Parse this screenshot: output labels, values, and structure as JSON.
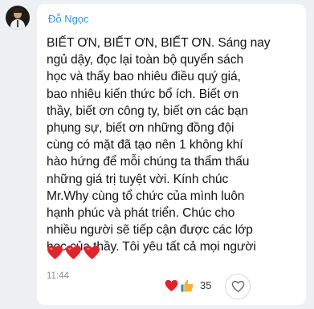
{
  "message": {
    "sender_name": "Đỗ Ngọc",
    "text": "BIẾT ƠN, BIẾT ƠN, BIẾT ƠN. Sáng nay\nngủ dậy, đọc lại toàn bộ quyển sách\nhọc và thấy bao nhiêu điều quý giá,\nbao nhiêu kiến thức bổ ích. Biết ơn\nthầy, biết ơn công ty, biết ơn các bạn\nphụng sự, biết ơn những đồng đội\ncùng có mặt đã tạo nên 1 không khí\nhào hứng để mỗi chúng ta thẩm thấu\nnhững giá trị tuyệt vời. Kính chúc\nMr.Why cùng tổ chức của mình luôn\nhạnh phúc và phát triển. Chúc cho\nnhiều người sẽ tiếp cận được các lớp\nhọc của thầy. Tôi yêu tất cả mọi người",
    "emoji": [
      "red-heart",
      "red-heart",
      "red-heart"
    ],
    "time": "11:44"
  },
  "reactions": {
    "icons": [
      "heart-emoji",
      "thumbs-up-emoji"
    ],
    "count": "35"
  },
  "colors": {
    "background": "#eef0f3",
    "bubble": "#ffffff",
    "sender_name": "#2f9ae0",
    "heart": "#e0242c",
    "thumb": "#f4b43a"
  }
}
